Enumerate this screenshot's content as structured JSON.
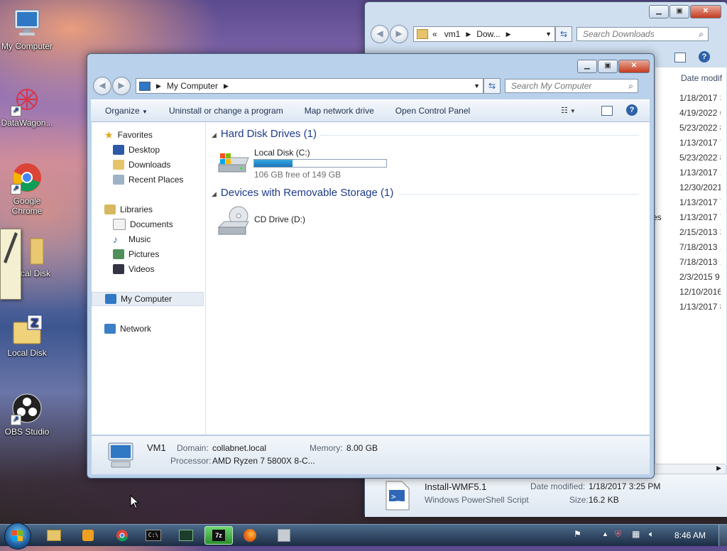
{
  "desktop": {
    "icons": [
      {
        "label": "My Computer"
      },
      {
        "label": "DataWagon..."
      },
      {
        "label": "Google Chrome"
      },
      {
        "label": "cal Disk"
      },
      {
        "label": "Local Disk"
      },
      {
        "label": "OBS Studio"
      }
    ]
  },
  "back_window": {
    "breadcrumb": {
      "prefix": "«",
      "items": [
        "vm1",
        "Dow..."
      ]
    },
    "search_placeholder": "Search Downloads",
    "column_header": "Date modif",
    "dates": [
      "1/18/2017 3",
      "4/19/2022 6",
      "5/23/2022 8",
      "1/13/2017 7",
      "5/23/2022 8",
      "1/13/2017 1",
      "12/30/2021",
      "1/13/2017 7",
      "1/13/2017 7",
      "2/15/2013 3",
      "7/18/2013 1",
      "7/18/2013 1",
      "2/3/2015 9:",
      "12/10/2016",
      "1/13/2017 8"
    ],
    "partial_text": "es",
    "details": {
      "name": "Install-WMF5.1",
      "type": "Windows PowerShell Script",
      "modified_label": "Date modified:",
      "modified_value": "1/18/2017 3:25 PM",
      "size_label": "Size:",
      "size_value": "16.2 KB"
    }
  },
  "front_window": {
    "breadcrumb": {
      "items": [
        "My Computer"
      ]
    },
    "search_placeholder": "Search My Computer",
    "toolbar": {
      "organize": "Organize",
      "uninstall": "Uninstall or change a program",
      "map_drive": "Map network drive",
      "control_panel": "Open Control Panel"
    },
    "nav": {
      "favorites": "Favorites",
      "desktop": "Desktop",
      "downloads": "Downloads",
      "recent": "Recent Places",
      "libraries": "Libraries",
      "documents": "Documents",
      "music": "Music",
      "pictures": "Pictures",
      "videos": "Videos",
      "mycomputer": "My Computer",
      "network": "Network"
    },
    "groups": {
      "hdd": "Hard Disk Drives (1)",
      "removable": "Devices with Removable Storage (1)"
    },
    "drives": {
      "c_name": "Local Disk (C:)",
      "c_free": "106 GB free of 149 GB",
      "c_used_fraction": 0.29,
      "d_name": "CD Drive (D:)"
    },
    "details": {
      "name": "VM1",
      "domain_label": "Domain:",
      "domain_value": "collabnet.local",
      "memory_label": "Memory:",
      "memory_value": "8.00 GB",
      "processor_label": "Processor:",
      "processor_value": "AMD Ryzen 7 5800X 8-C..."
    }
  },
  "taskbar": {
    "clock": "8:46 AM"
  },
  "colors": {
    "accent": "#1e3b8a",
    "progress": "#1a74b8",
    "close": "#c43c1e"
  }
}
